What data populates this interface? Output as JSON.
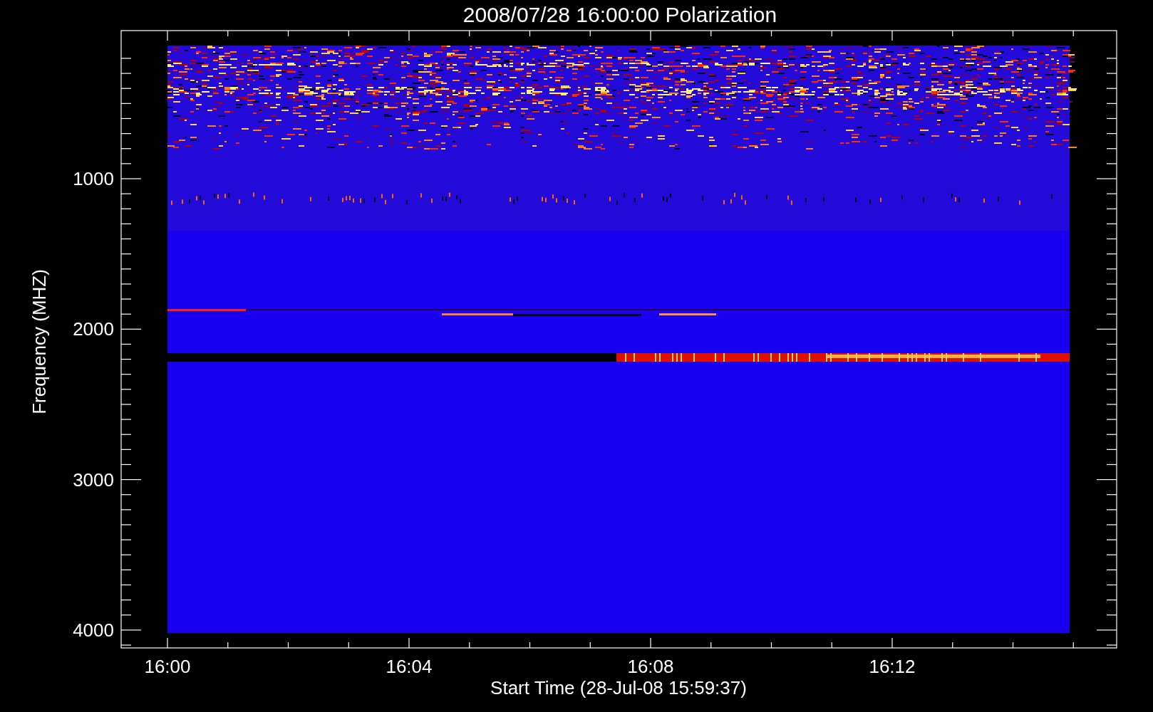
{
  "title": "2008/07/28 16:00:00 Polarization",
  "x_axis": {
    "label": "Start Time (28-Jul-08 15:59:37)",
    "ticks": [
      "16:00",
      "16:04",
      "16:08",
      "16:12"
    ]
  },
  "y_axis": {
    "label": "Frequency (MHZ)",
    "ticks": [
      "1000",
      "2000",
      "3000",
      "4000"
    ]
  }
}
